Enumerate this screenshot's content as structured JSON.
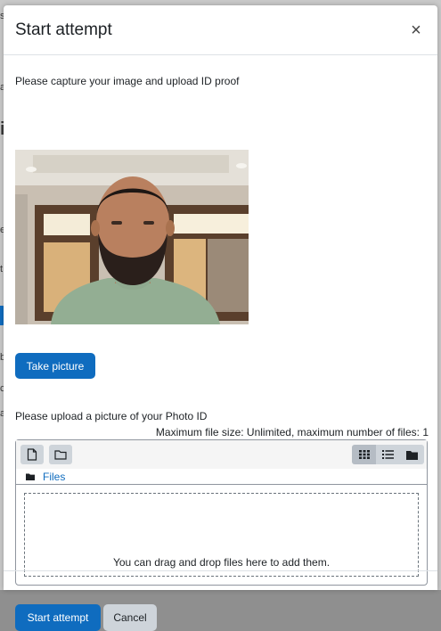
{
  "modal": {
    "title": "Start attempt",
    "close_label": "×"
  },
  "camera_section": {
    "instruction": "Please capture your image and upload ID proof",
    "take_picture_label": "Take picture"
  },
  "upload_section": {
    "instruction": "Please upload a picture of your Photo ID",
    "limits": "Maximum file size: Unlimited, maximum number of files: 1",
    "path_label": "Files",
    "dropzone_text": "You can drag and drop files here to add them.",
    "view_modes": [
      "icons-view-icon",
      "list-view-icon",
      "tree-view-icon"
    ],
    "active_view": "icons-view-icon"
  },
  "footer": {
    "start_label": "Start attempt",
    "cancel_label": "Cancel"
  },
  "background_fragments": [
    "s",
    "a",
    "i",
    "e",
    "t",
    "b",
    "c",
    "a"
  ],
  "colors": {
    "primary": "#0f6cbf",
    "secondary": "#ced4da",
    "text": "#1d2125"
  }
}
